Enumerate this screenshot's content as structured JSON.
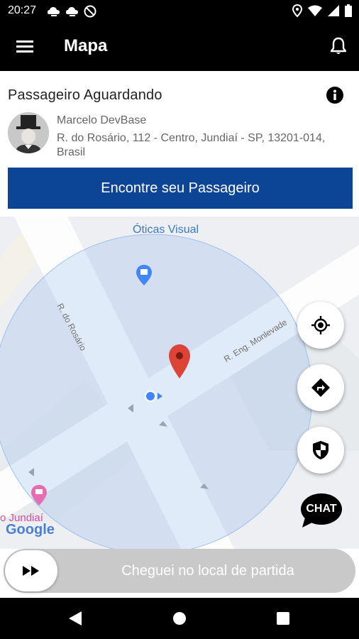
{
  "status_bar": {
    "time": "20:27"
  },
  "app_bar": {
    "title": "Mapa"
  },
  "passenger_card": {
    "heading": "Passageiro Aguardando",
    "name": "Marcelo DevBase",
    "address": "R. do Rosário, 112 - Centro, Jundiaí - SP, 13201-014, Brasil",
    "find_button": "Encontre seu Passageiro"
  },
  "map": {
    "poi_top": "Óticas Visual",
    "street_1": "R. do Rosário",
    "street_2": "R. Eng. Monlevade",
    "poi_bottom": "o Jundiaí",
    "google_logo": "Google",
    "chat_label": "CHAT"
  },
  "slider": {
    "label": "Cheguei no local de partida"
  },
  "colors": {
    "primary": "#0c4596",
    "marker": "#db4437",
    "appbar": "#000000"
  }
}
